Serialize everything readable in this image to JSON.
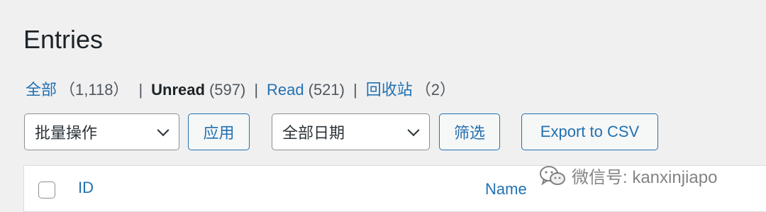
{
  "header": {
    "title": "Entries"
  },
  "filters": {
    "all": {
      "label": "全部",
      "count": "（1,118）"
    },
    "unread": {
      "label": "Unread",
      "count": "(597)"
    },
    "read": {
      "label": "Read",
      "count": "(521)"
    },
    "trash": {
      "label": "回收站",
      "count": "（2）"
    },
    "separator": "|"
  },
  "toolbar": {
    "bulk_actions": "批量操作",
    "apply_label": "应用",
    "date_filter": "全部日期",
    "filter_label": "筛选",
    "export_label": "Export to CSV"
  },
  "table": {
    "columns": [
      "ID",
      "Name"
    ]
  },
  "watermark": {
    "text": "微信号: kanxinjiapo",
    "icon": "wechat-icon"
  },
  "colors": {
    "accent": "#2271b1",
    "background": "#f0f0f1",
    "text": "#1d2327"
  }
}
